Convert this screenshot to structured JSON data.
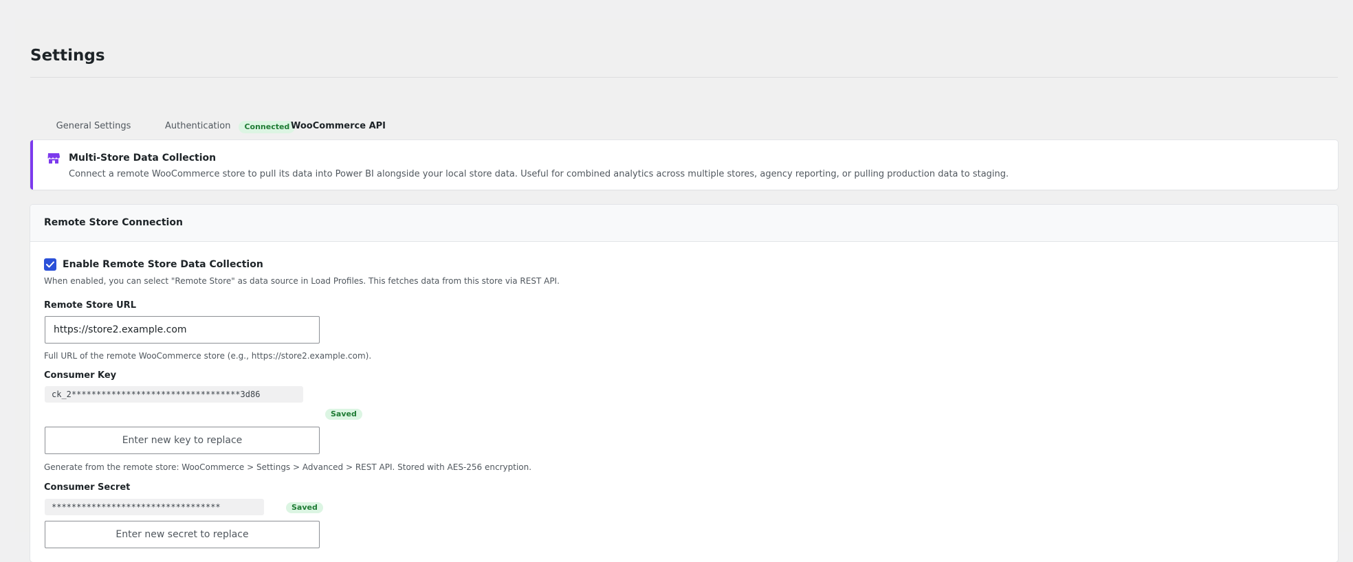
{
  "page": {
    "title": "Settings"
  },
  "tabs": [
    {
      "label": "General Settings"
    },
    {
      "label": "Authentication",
      "badge": "Connected"
    },
    {
      "label": "WooCommerce API"
    }
  ],
  "notice": {
    "title": "Multi-Store Data Collection",
    "text": "Connect a remote WooCommerce store to pull its data into Power BI alongside your local store data. Useful for combined analytics across multiple stores, agency reporting, or pulling production data to staging."
  },
  "panel": {
    "title": "Remote Store Connection",
    "enable": {
      "label": "Enable Remote Store Data Collection",
      "help": "When enabled, you can select \"Remote Store\" as data source in Load Profiles. This fetches data from this store via REST API."
    },
    "url": {
      "label": "Remote Store URL",
      "value": "https://store2.example.com",
      "help": "Full URL of the remote WooCommerce store (e.g., https://store2.example.com)."
    },
    "key": {
      "label": "Consumer Key",
      "masked": "ck_2**********************************3d86",
      "saved": "Saved",
      "placeholder": "Enter new key to replace",
      "help": "Generate from the remote store: WooCommerce > Settings > Advanced > REST API. Stored with AES-256 encryption."
    },
    "secret": {
      "label": "Consumer Secret",
      "masked": "**********************************",
      "saved": "Saved",
      "placeholder": "Enter new secret to replace"
    }
  },
  "colors": {
    "accent": "#2271b1",
    "notice_border": "#7c3aed",
    "checkbox": "#2b50d8",
    "badge_bg": "#dcf5e3",
    "badge_text": "#1e7b34"
  },
  "icons": {
    "notice": "store-icon",
    "checkbox": "checkmark-icon"
  }
}
